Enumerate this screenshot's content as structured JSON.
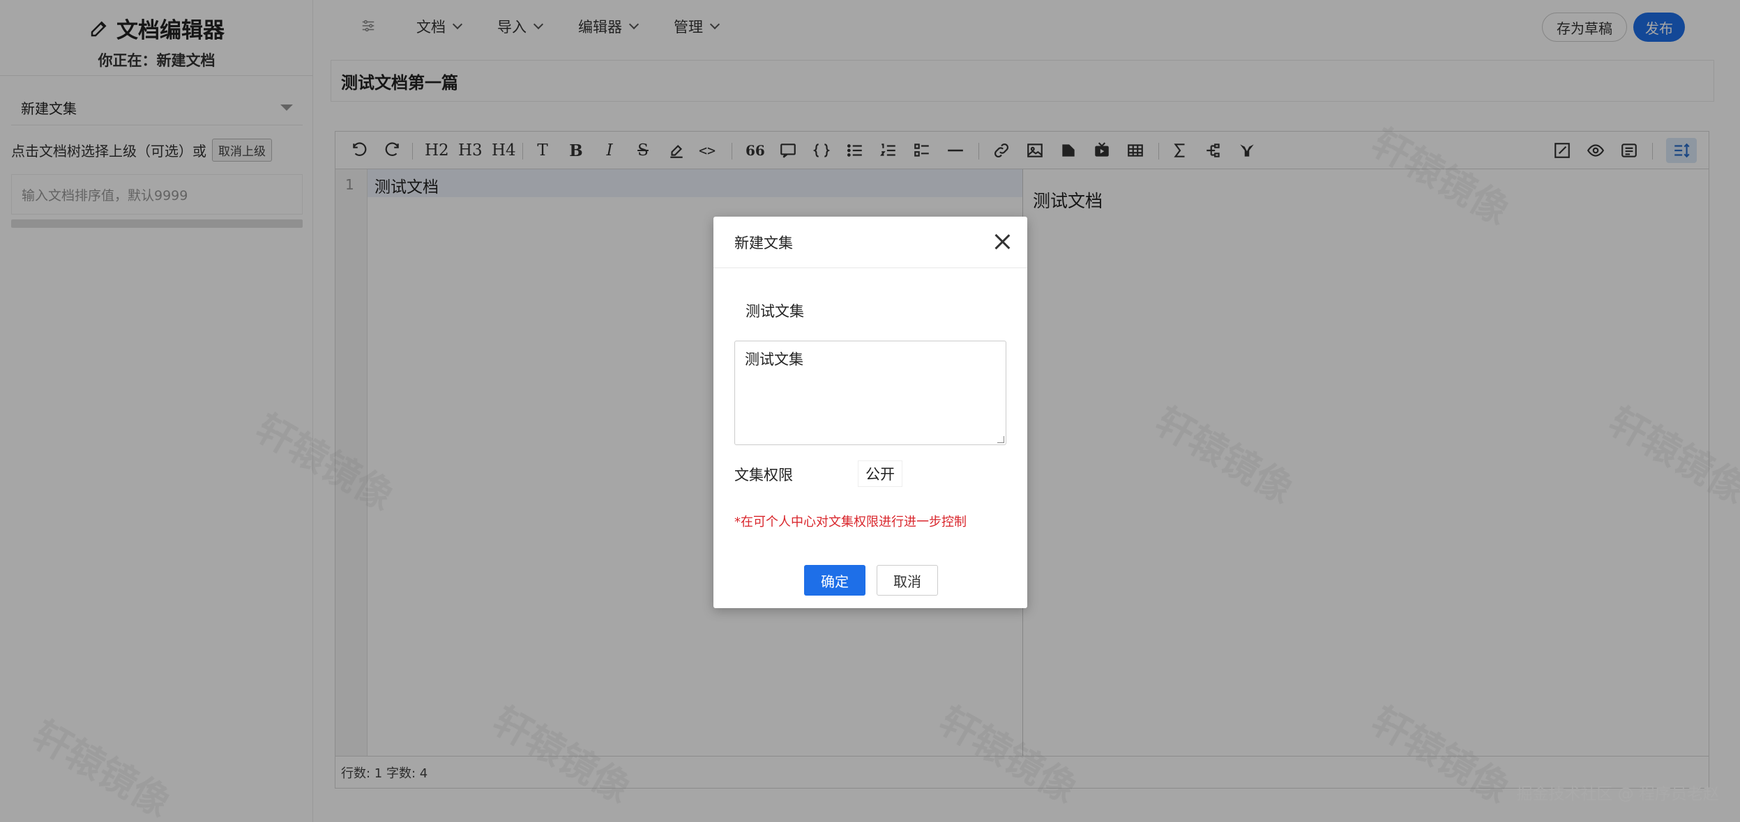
{
  "sidebar": {
    "brand_title": "文档编辑器",
    "location_label": "你正在：新建文档",
    "collection_selected": "新建文集",
    "parent_hint": "点击文档树选择上级（可选）或",
    "cancel_parent_label": "取消上级",
    "sort_placeholder": "输入文档排序值，默认9999"
  },
  "topnav": {
    "menus": [
      {
        "label": "文档"
      },
      {
        "label": "导入"
      },
      {
        "label": "编辑器"
      },
      {
        "label": "管理"
      }
    ],
    "save_draft_label": "存为草稿",
    "publish_label": "发布",
    "publish_color": "#1e6fe8"
  },
  "document": {
    "title": "测试文档第一篇",
    "line_number": "1",
    "content": "测试文档",
    "preview": "测试文档",
    "status": "行数: 1 字数: 4"
  },
  "toolbar": {
    "h2": "H2",
    "h3": "H3",
    "h4": "H4",
    "text": "T",
    "bold": "B",
    "italic": "I",
    "strike": "S",
    "code": "<>",
    "quote": "66",
    "icons": [
      "undo-icon",
      "redo-icon",
      "h2",
      "h3",
      "h4",
      "text",
      "bold",
      "italic",
      "strikethrough",
      "highlight-icon",
      "code",
      "quote",
      "comment-icon",
      "code-block-icon",
      "bullet-list-icon",
      "ordered-list-icon",
      "checklist-icon",
      "hr-icon",
      "link-icon",
      "image-icon",
      "attachment-icon",
      "video-icon",
      "table-icon",
      "formula-icon",
      "mindmap-icon",
      "graph-icon",
      "edit-mode-icon",
      "preview-icon",
      "split-icon",
      "toc-icon"
    ]
  },
  "modal": {
    "title": "新建文集",
    "name": "测试文集",
    "description": "测试文集",
    "permission_label": "文集权限",
    "permission_value": "公开",
    "note": "*在可个人中心对文集权限进行进一步控制",
    "ok_label": "确定",
    "cancel_label": "取消",
    "note_color": "#d9262c"
  },
  "watermark": {
    "text": "轩辕镜像",
    "footer": "掘金技术社区 @ 程序员老赵"
  }
}
